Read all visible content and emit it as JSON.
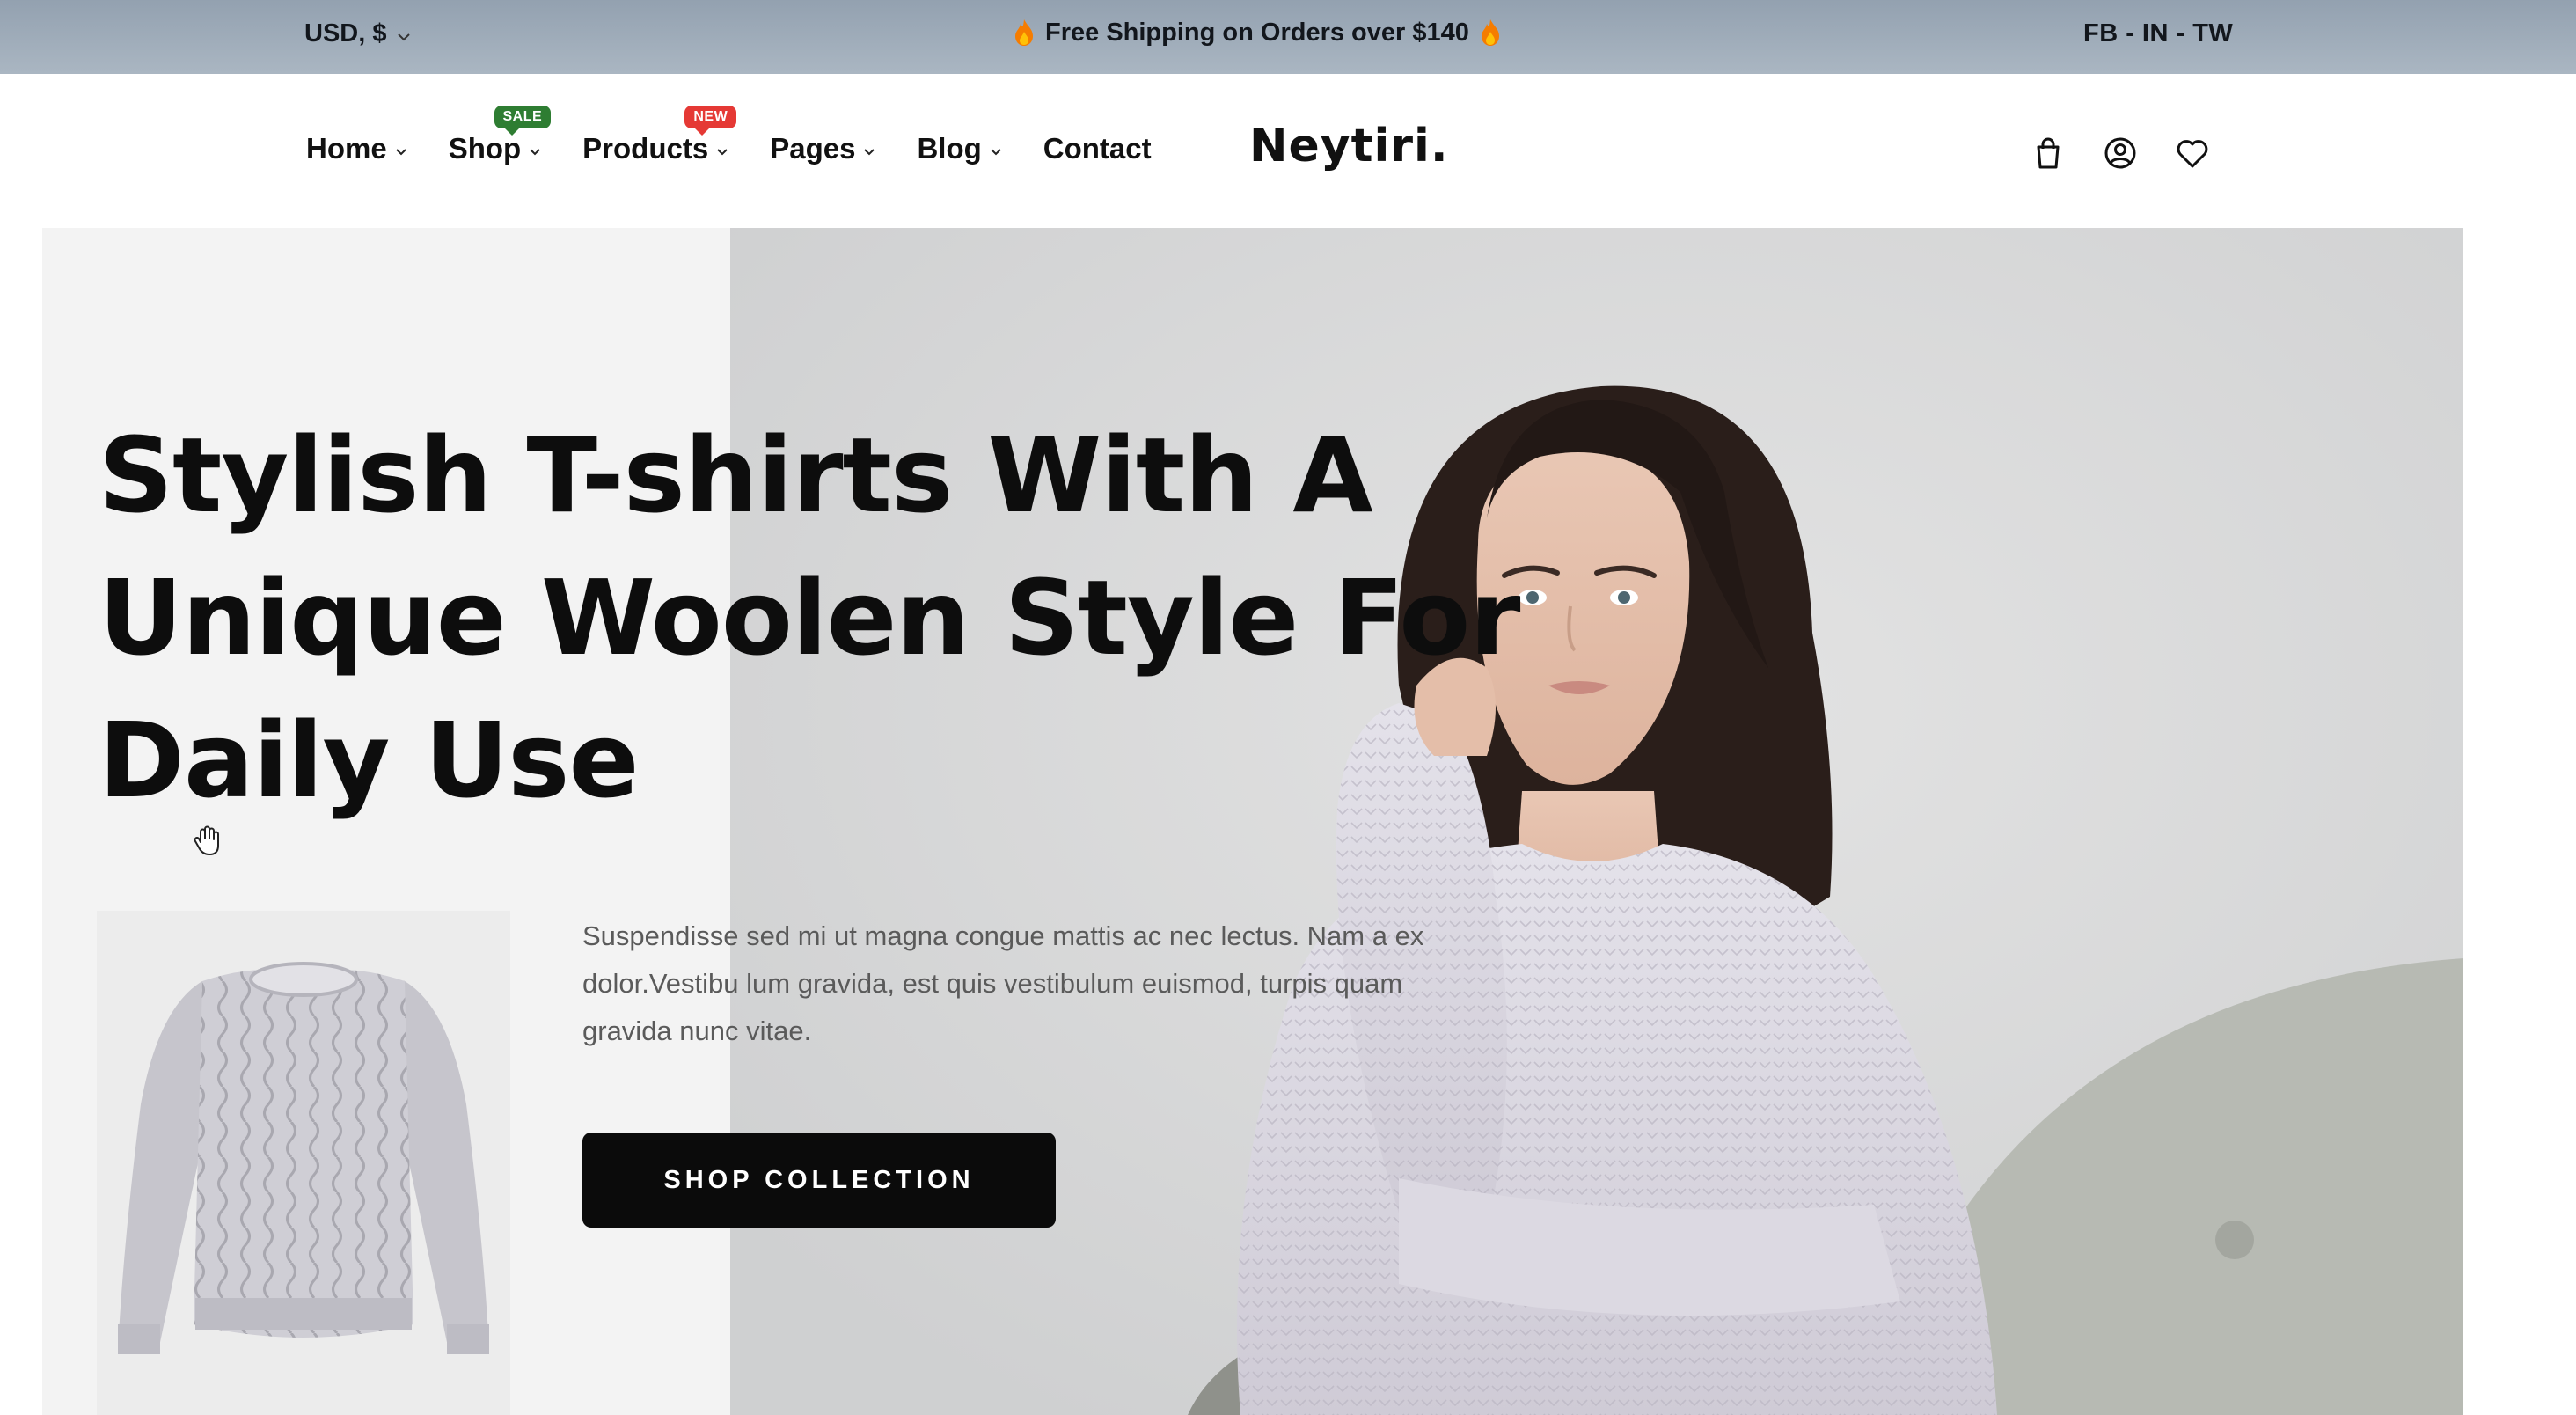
{
  "topbar": {
    "currency": "USD, $",
    "promo": "Free Shipping on Orders over $140",
    "social": "FB - IN - TW"
  },
  "nav": {
    "items": [
      {
        "label": "Home",
        "dropdown": true
      },
      {
        "label": "Shop",
        "dropdown": true,
        "badge": "SALE"
      },
      {
        "label": "Products",
        "dropdown": true,
        "badge": "NEW"
      },
      {
        "label": "Pages",
        "dropdown": true
      },
      {
        "label": "Blog",
        "dropdown": true
      },
      {
        "label": "Contact",
        "dropdown": false
      }
    ]
  },
  "brand": {
    "logo": "Neytiri."
  },
  "header_icons": [
    "shopping-bag-icon",
    "user-account-icon",
    "wishlist-heart-icon"
  ],
  "hero": {
    "headline_lines": [
      "Stylish T-shirts With A",
      "Unique Woolen Style For",
      "Daily Use"
    ],
    "description": "Suspendisse sed mi ut magna congue mattis ac nec lectus. Nam a ex dolor.Vestibu lum gravida, est quis vestibulum euismod, turpis quam gravida nunc vitae.",
    "cta_label": "SHOP COLLECTION"
  },
  "colors": {
    "topbar_bg": "#9ba8b6",
    "badge_sale": "#2e7d32",
    "badge_new": "#e53935",
    "cta_bg": "#0b0b0b"
  }
}
